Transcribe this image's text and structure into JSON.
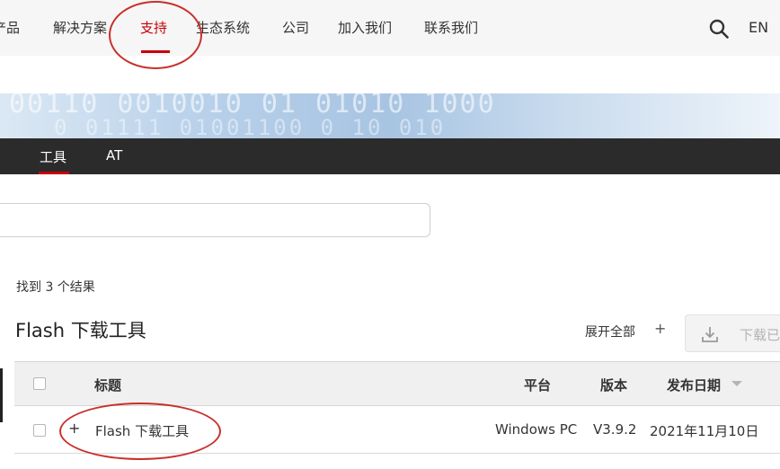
{
  "nav": {
    "items": [
      "产品",
      "解决方案",
      "支持",
      "生态系统",
      "公司",
      "加入我们",
      "联系我们"
    ],
    "active_index": 2,
    "lang": "EN"
  },
  "banner": {
    "digits_line1": "00110 0010010 01 01010 1000",
    "digits_line2": "0 01111 01001100 0 10 010"
  },
  "subnav": {
    "tabs": [
      "工具",
      "AT"
    ],
    "active_index": 0
  },
  "search": {
    "placeholder": ""
  },
  "results": {
    "count_text": "找到 3 个结果",
    "section_title": "Flash 下载工具",
    "expand_all": "展开全部",
    "expand_plus": "+",
    "download_label": "下载已"
  },
  "table": {
    "columns": {
      "title": "标题",
      "platform": "平台",
      "version": "版本",
      "date": "发布日期"
    },
    "rows": [
      {
        "expand": "+",
        "title": "Flash 下载工具",
        "platform": "Windows PC",
        "version": "V3.9.2",
        "date": "2021年11月10日"
      }
    ]
  },
  "colors": {
    "accent": "#c7000b",
    "subbar": "#2b2b2b",
    "annotation": "#c9302c"
  }
}
